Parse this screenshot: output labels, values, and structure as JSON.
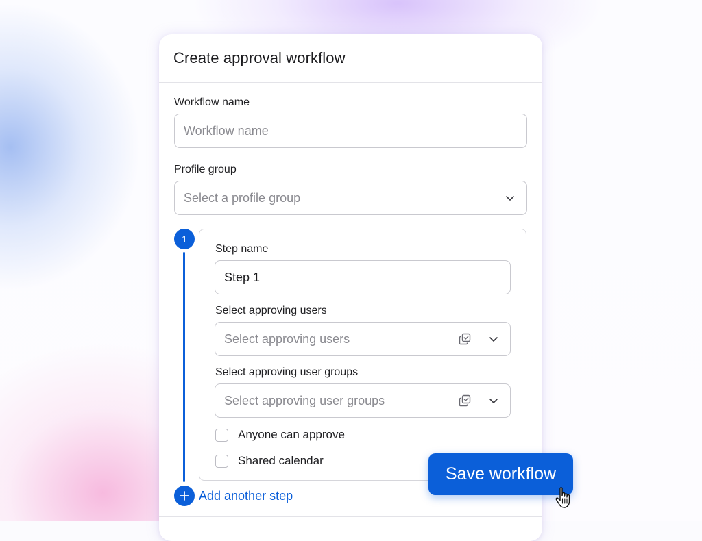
{
  "form": {
    "title": "Create approval workflow",
    "workflow_name": {
      "label": "Workflow name",
      "placeholder": "Workflow name"
    },
    "profile_group": {
      "label": "Profile group",
      "placeholder": "Select a profile group"
    }
  },
  "step": {
    "number": "1",
    "step_name": {
      "label": "Step name",
      "value": "Step 1"
    },
    "approving_users": {
      "label": "Select approving users",
      "placeholder": "Select approving users"
    },
    "approving_user_groups": {
      "label": "Select approving user groups",
      "placeholder": "Select approving user groups"
    },
    "checkboxes": [
      {
        "label": "Anyone can approve",
        "checked": false
      },
      {
        "label": "Shared calendar",
        "checked": false
      }
    ]
  },
  "actions": {
    "add_step_label": "Add another step",
    "save_label": "Save workflow"
  },
  "colors": {
    "accent": "#0b5fd9",
    "border": "#c9c9cf",
    "text": "#1c1c1f",
    "placeholder": "#8a8a90"
  },
  "icons": {
    "dropdown": "chevron-down-icon",
    "multi_select": "copy-check-icon",
    "add": "plus-icon",
    "cursor": "hand-pointer-icon"
  }
}
